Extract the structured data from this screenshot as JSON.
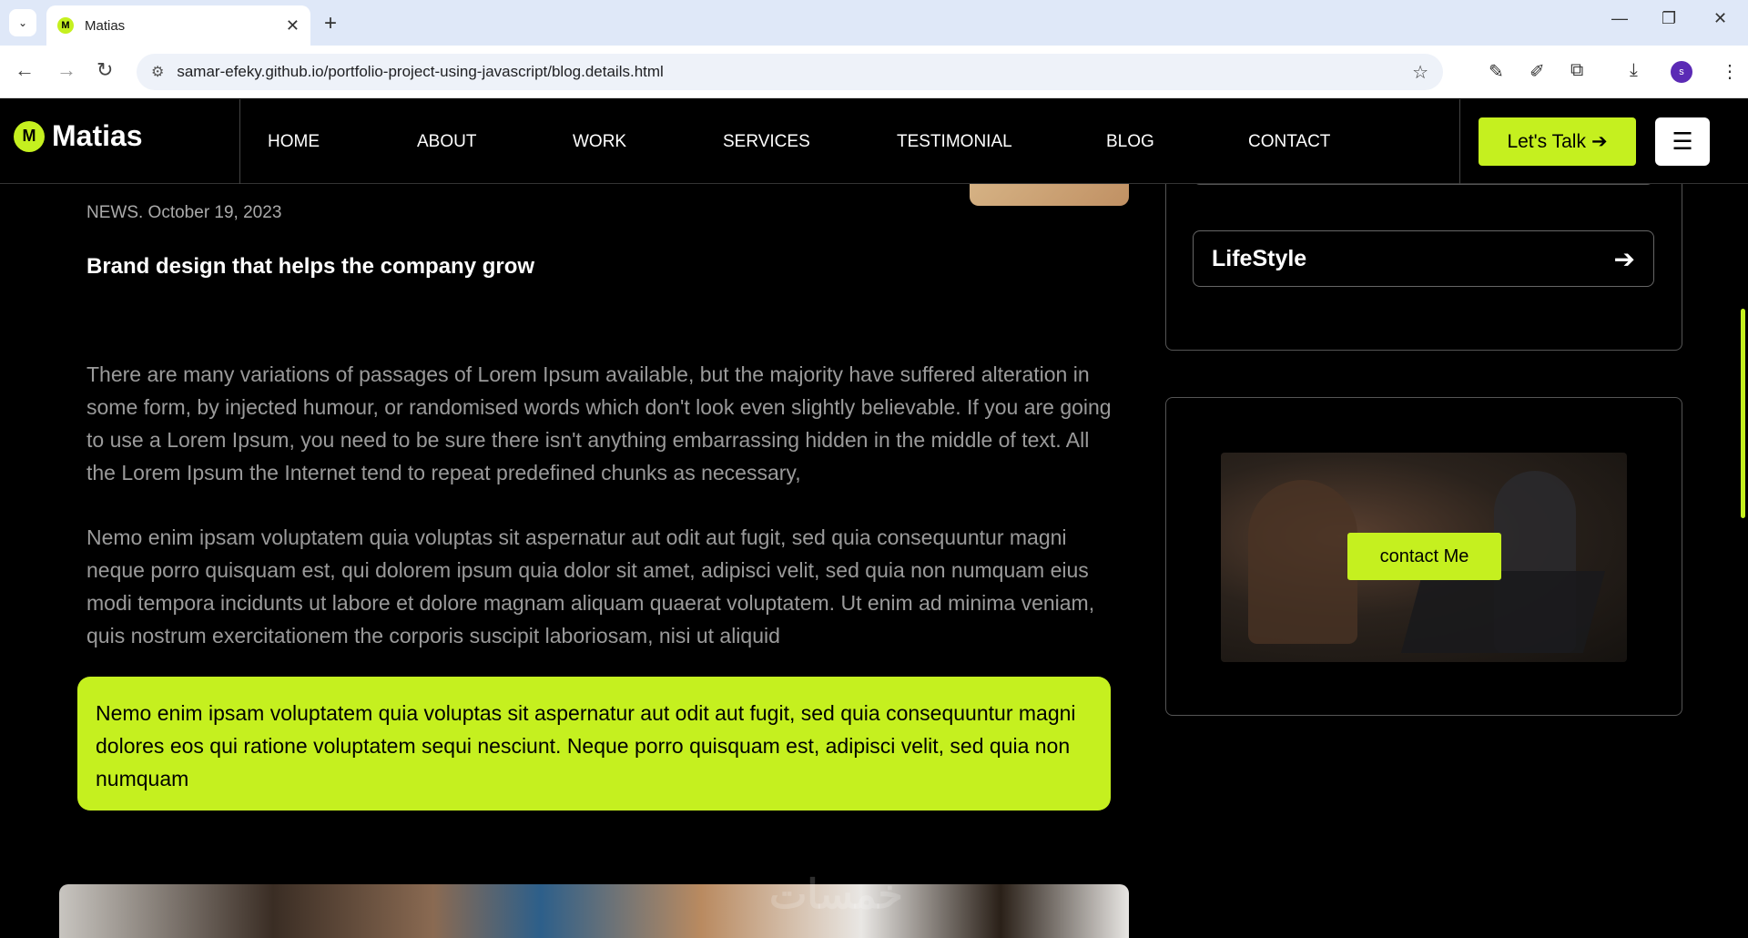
{
  "browser": {
    "tab_title": "Matias",
    "url": "samar-efeky.github.io/portfolio-project-using-javascript/blog.details.html",
    "profile_initial": "s"
  },
  "site": {
    "brand": "Matias",
    "nav": [
      "HOME",
      "ABOUT",
      "WORK",
      "SERVICES",
      "TESTIMONIAL",
      "BLOG",
      "CONTACT"
    ],
    "cta_label": "Let's Talk"
  },
  "article": {
    "meta": "NEWS. October 19, 2023",
    "title": "Brand design that helps the company grow",
    "paragraph_1": "There are many variations of passages of Lorem Ipsum available, but the majority have suffered alteration in some form, by injected humour, or randomised words which don't look even slightly believable. If you are going to use a Lorem Ipsum, you need to be sure there isn't anything embarrassing hidden in the middle of text. All the Lorem Ipsum the Internet tend to repeat predefined chunks as necessary,",
    "paragraph_2": "Nemo enim ipsam voluptatem quia voluptas sit aspernatur aut odit aut fugit, sed quia consequuntur magni neque porro quisquam est, qui dolorem ipsum quia dolor sit amet, adipisci velit, sed quia non numquam eius modi tempora incidunts ut labore et dolore magnam aliquam quaerat voluptatem. Ut enim ad minima veniam, quis nostrum exercitationem the corporis suscipit laboriosam, nisi ut aliquid",
    "quote": "Nemo enim ipsam voluptatem quia voluptas sit aspernatur aut odit aut fugit, sed quia consequuntur magni dolores eos qui ratione voluptatem sequi nesciunt. Neque porro quisquam est, adipisci velit, sed quia non numquam"
  },
  "sidebar": {
    "category": "LifeStyle",
    "contact_label": "contact Me"
  },
  "watermark": "خمسات",
  "colors": {
    "accent": "#c5f01f",
    "background": "#000000"
  }
}
